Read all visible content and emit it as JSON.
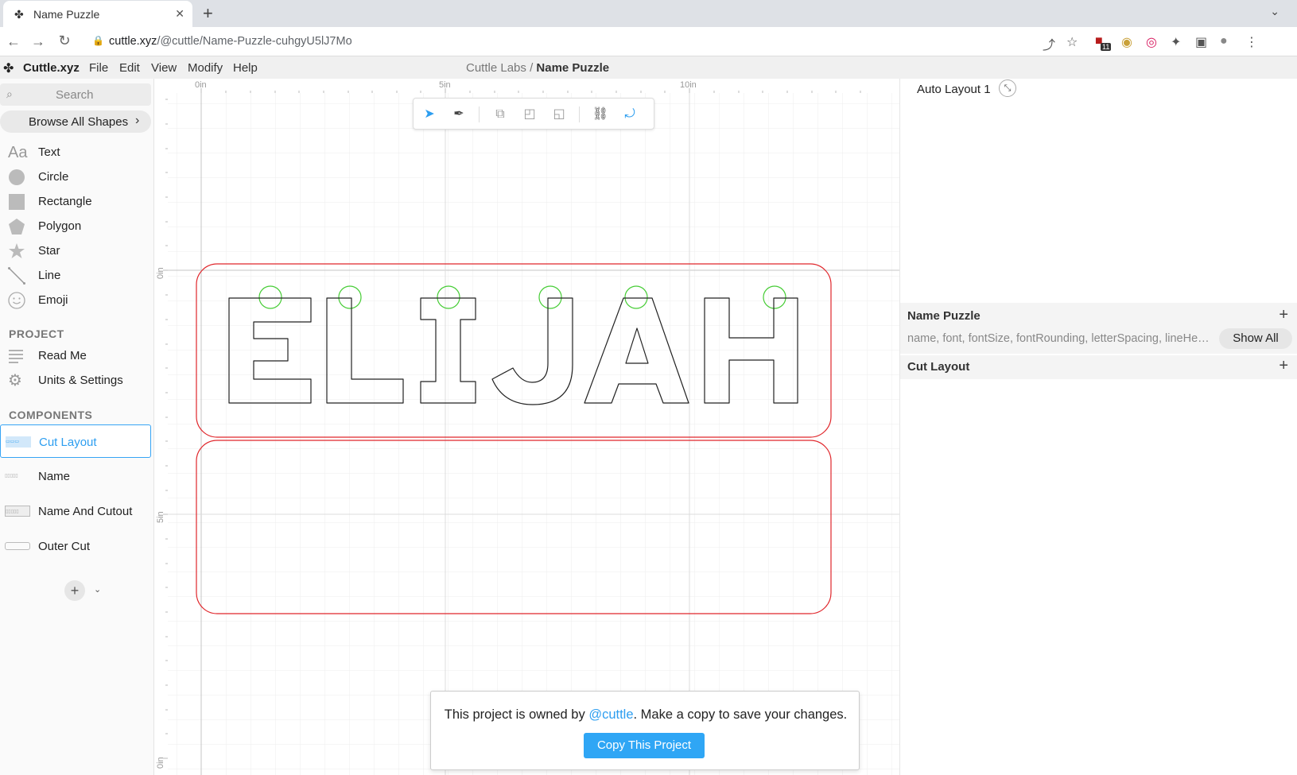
{
  "browser": {
    "tab_title": "Name Puzzle",
    "url_host": "cuttle.xyz",
    "url_path": "/@cuttle/Name-Puzzle-cuhgyU5lJ7Mo",
    "ext_badge": "11"
  },
  "app": {
    "name": "Cuttle.xyz",
    "menu": [
      "File",
      "Edit",
      "View",
      "Modify",
      "Help"
    ],
    "breadcrumb_parent": "Cuttle Labs",
    "breadcrumb_sep": "/",
    "breadcrumb_current": "Name Puzzle"
  },
  "sidebar": {
    "search_placeholder": "Search",
    "browse_label": "Browse All Shapes",
    "shapes": [
      {
        "label": "Text",
        "icon": "text-icon"
      },
      {
        "label": "Circle",
        "icon": "circle-icon"
      },
      {
        "label": "Rectangle",
        "icon": "rectangle-icon"
      },
      {
        "label": "Polygon",
        "icon": "polygon-icon"
      },
      {
        "label": "Star",
        "icon": "star-icon"
      },
      {
        "label": "Line",
        "icon": "line-icon"
      },
      {
        "label": "Emoji",
        "icon": "emoji-icon"
      }
    ],
    "project_header": "PROJECT",
    "project_items": [
      {
        "label": "Read Me",
        "icon": "document-icon"
      },
      {
        "label": "Units & Settings",
        "icon": "gear-icon"
      }
    ],
    "components_header": "COMPONENTS",
    "components": [
      {
        "label": "Cut Layout",
        "selected": true
      },
      {
        "label": "Name",
        "selected": false
      },
      {
        "label": "Name And Cutout",
        "selected": false
      },
      {
        "label": "Outer Cut",
        "selected": false
      }
    ]
  },
  "canvas": {
    "ruler_x": [
      "0in",
      "5in",
      "10in"
    ],
    "ruler_y": [
      "0in",
      "5in",
      "0in"
    ],
    "letters": "ELIJAH",
    "accent": "#e0262b",
    "hole_color": "#44cc33"
  },
  "toast": {
    "message_before": "This project is owned by ",
    "owner": "@cuttle",
    "message_after": ". Make a copy to save your changes.",
    "button": "Copy This Project"
  },
  "rpanel": {
    "auto_layout": "Auto Layout 1",
    "sections": [
      {
        "title": "Name Puzzle",
        "params": "name, font, fontSize, fontRounding, letterSpacing, lineHeig…",
        "show_all": "Show All"
      },
      {
        "title": "Cut Layout"
      }
    ]
  }
}
